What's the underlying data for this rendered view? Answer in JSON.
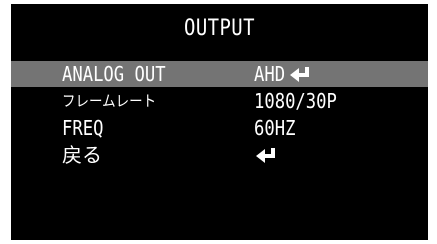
{
  "menu": {
    "title": "OUTPUT",
    "items": [
      {
        "label": "ANALOG OUT",
        "value": "AHD",
        "icon": "enter-arrow-icon",
        "selected": true
      },
      {
        "label": "フレームレート",
        "value": "1080/30P",
        "selected": false
      },
      {
        "label": "FREQ",
        "value": "60HZ",
        "selected": false
      },
      {
        "label": "戻る",
        "value": "",
        "icon": "enter-arrow-icon",
        "selected": false
      }
    ]
  },
  "colors": {
    "background": "#000000",
    "text": "#ffffff",
    "highlight": "#747474"
  }
}
